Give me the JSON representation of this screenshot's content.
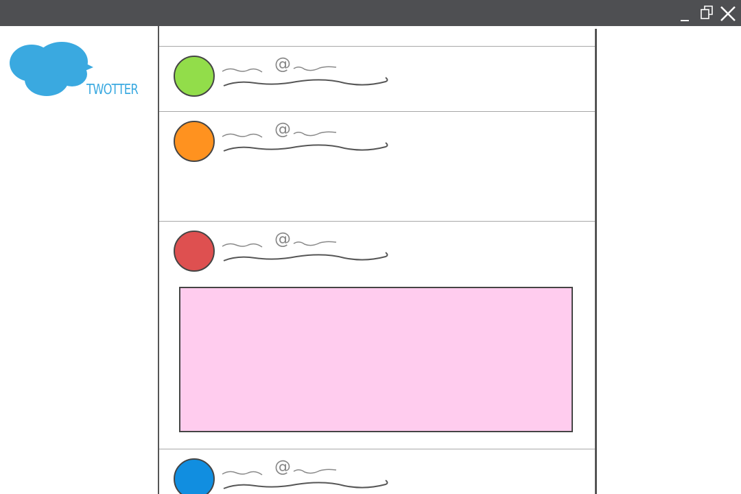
{
  "window": {
    "controls": [
      "minimize-icon",
      "restore-icon",
      "close-icon"
    ],
    "titlebar_color": "#4e4f52"
  },
  "brand": {
    "name": "TWOTTER",
    "logo_color": "#3aa9e0"
  },
  "feed": {
    "tweets": [
      {
        "avatar_color": "#92dd4a",
        "has_media": false
      },
      {
        "avatar_color": "#ff921f",
        "has_media": false
      },
      {
        "avatar_color": "#de5050",
        "has_media": true,
        "media_color": "#ffccee"
      },
      {
        "avatar_color": "#118ee0",
        "has_media": false
      }
    ]
  }
}
